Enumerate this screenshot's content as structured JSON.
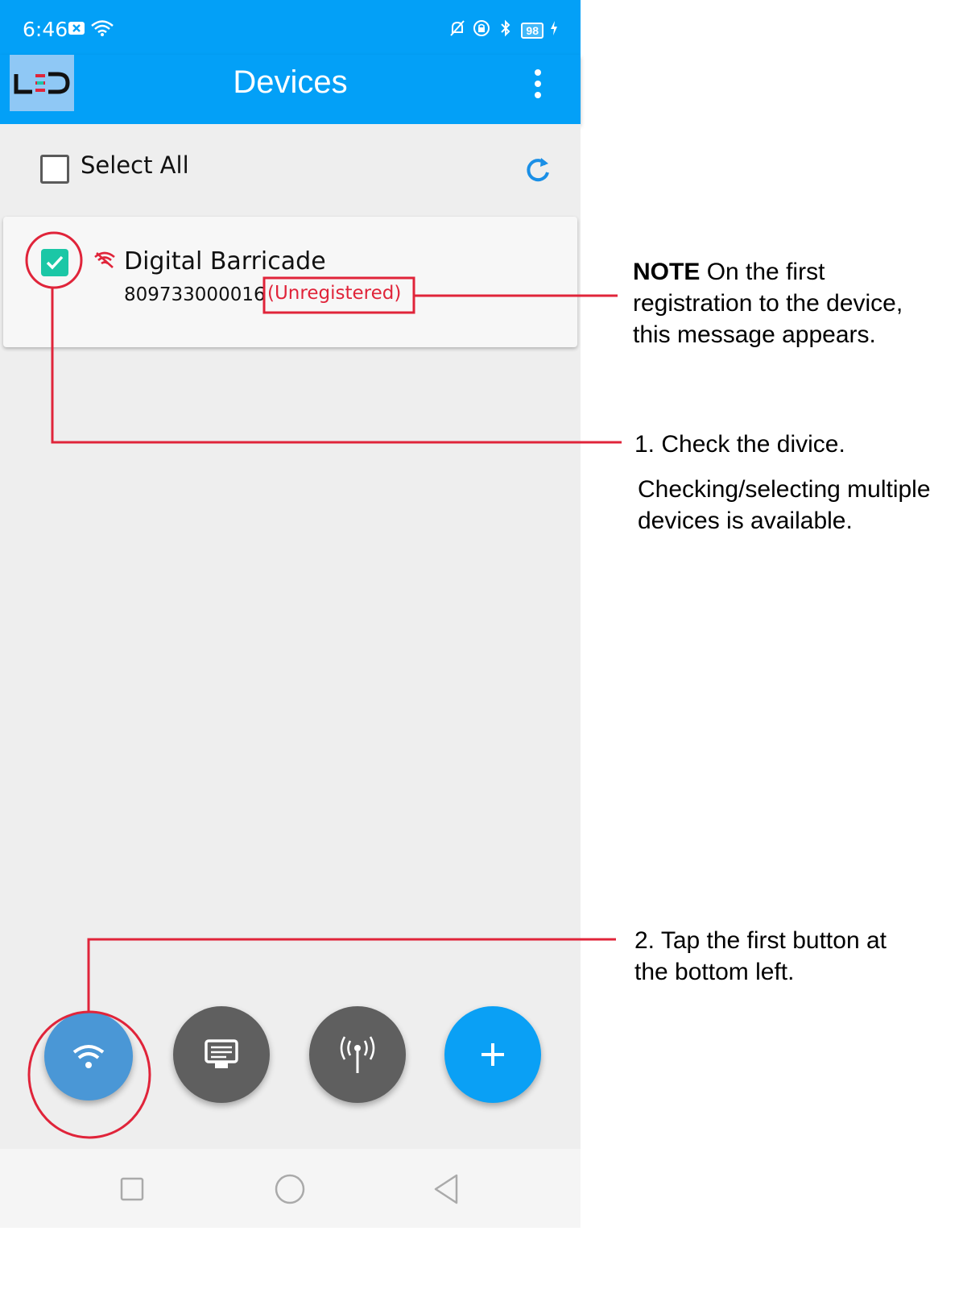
{
  "status_bar": {
    "time": "6:46",
    "battery": "98"
  },
  "app_bar": {
    "logo_text": "LED",
    "title": "Devices"
  },
  "select_all": {
    "label": "Select All"
  },
  "device": {
    "name": "Digital Barricade",
    "serial": "809733000016",
    "status": "(Unregistered)",
    "checked": true
  },
  "fabs": [
    {
      "name": "wifi-connect",
      "color": "#4a97d6"
    },
    {
      "name": "display-settings",
      "color": "#5f5f5f"
    },
    {
      "name": "broadcast",
      "color": "#5f5f5f"
    },
    {
      "name": "add",
      "color": "#0aa0f5"
    }
  ],
  "annotations": {
    "note_label": "NOTE",
    "note_text_1": "On the first",
    "note_text_2": "registration to the device,",
    "note_text_3": "this message appears.",
    "step1_line1": "1. Check the divice.",
    "step1_line2": "Checking/selecting multiple",
    "step1_line3": "devices is available.",
    "step2_line1": "2. Tap the first button at",
    "step2_line2": "the bottom left."
  },
  "colors": {
    "accent": "#03a0f7",
    "annotation_red": "#e0243a",
    "check_green": "#1bc7a6"
  }
}
